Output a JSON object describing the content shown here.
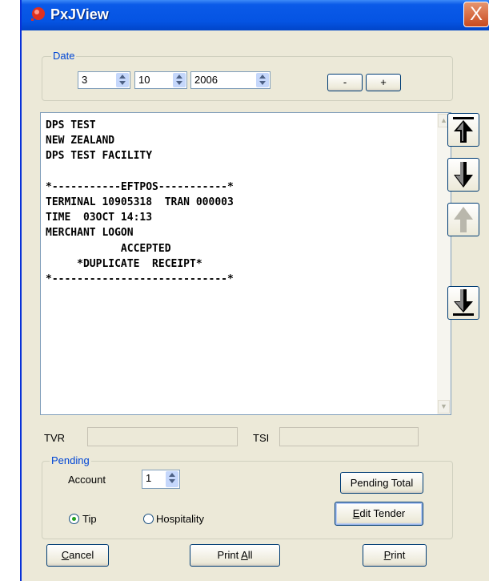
{
  "window": {
    "title": "PxJView",
    "close_label": "X"
  },
  "date_group": {
    "legend": "Date",
    "day": "3",
    "month": "10",
    "year": "2006",
    "minus_label": "-",
    "plus_label": "+"
  },
  "receipt": {
    "lines": [
      "DPS TEST",
      "NEW ZEALAND",
      "DPS TEST FACILITY",
      "",
      "*-----------EFTPOS-----------*",
      "TERMINAL 10905318  TRAN 000003",
      "TIME  03OCT 14:13",
      "MERCHANT LOGON",
      "            ACCEPTED",
      "     *DUPLICATE  RECEIPT*",
      "*----------------------------*"
    ]
  },
  "fields": {
    "tvr_label": "TVR",
    "tvr_value": "",
    "tsi_label": "TSI",
    "tsi_value": ""
  },
  "pending": {
    "legend": "Pending",
    "account_label": "Account",
    "account_value": "1",
    "pending_total_label": "Pending Total",
    "edit_tender_label": "Edit Tender",
    "tip_label": "Tip",
    "hospitality_label": "Hospitality",
    "selected": "Tip"
  },
  "buttons": {
    "cancel": "Cancel",
    "print_all": "Print All",
    "print": "Print"
  },
  "icons": {
    "nav_first": "scroll-top-icon",
    "nav_down": "scroll-down-icon",
    "nav_up": "scroll-up-icon",
    "nav_last": "scroll-bottom-icon"
  }
}
